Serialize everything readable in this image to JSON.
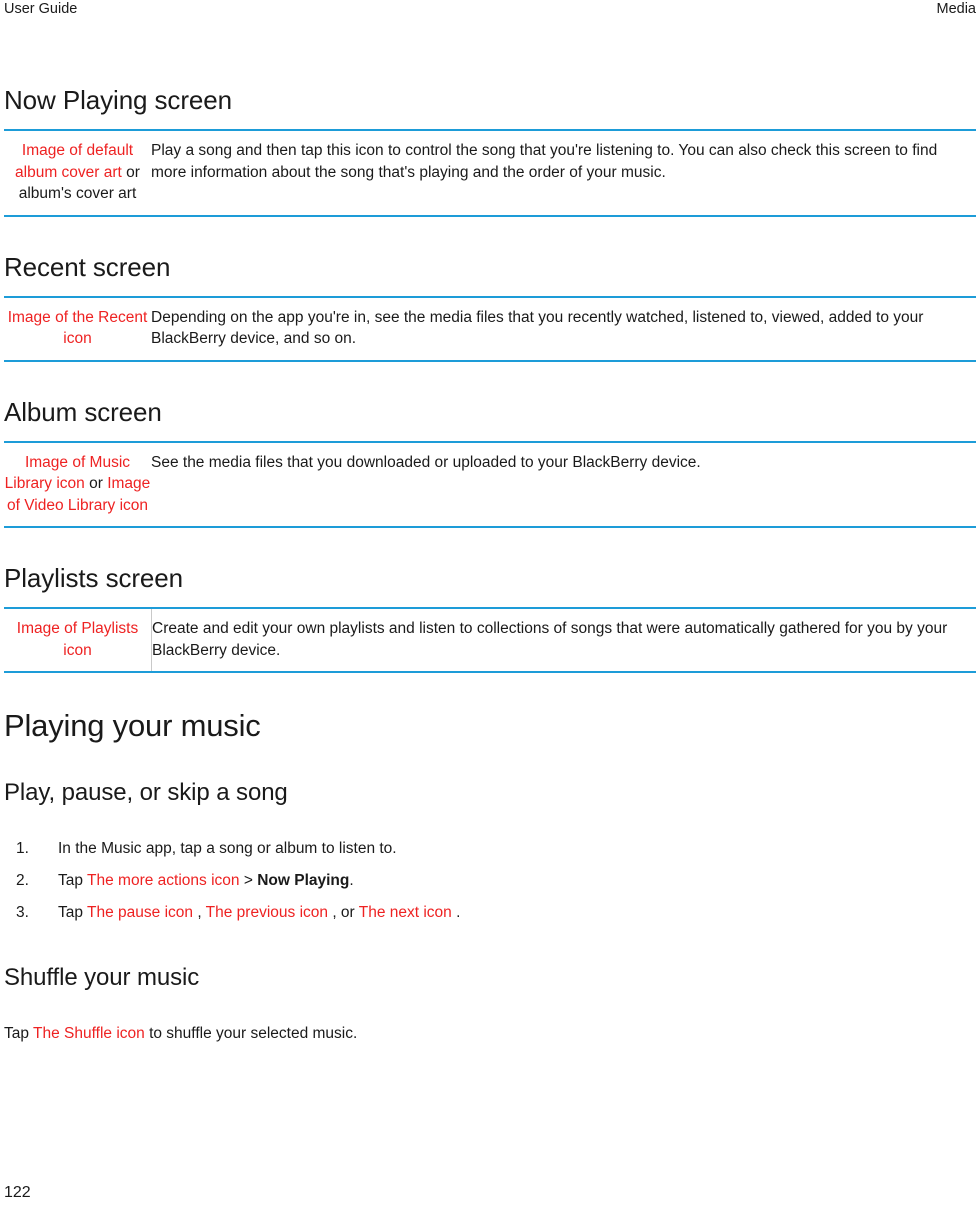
{
  "header": {
    "left": "User Guide",
    "right": "Media"
  },
  "accent_color": "#1d9cd8",
  "image_ref_color": "#ee2222",
  "sections": {
    "now_playing": {
      "heading": "Now Playing screen",
      "row": {
        "icon_ref_1": "Image of default album cover art",
        "connector": "or",
        "icon_ref_2": "album's cover art",
        "description": "Play a song and then tap this icon to control the song that you're listening to. You can also check this screen to find more information about the song that's playing and the order of your music."
      }
    },
    "recent": {
      "heading": "Recent screen",
      "row": {
        "icon_ref_1": "Image of the Recent icon",
        "description": "Depending on the app you're in, see the media files that you recently watched, listened to, viewed, added to your BlackBerry device, and so on."
      }
    },
    "album": {
      "heading": "Album screen",
      "row": {
        "icon_ref_1": "Image of Music Library icon",
        "connector": "or",
        "icon_ref_2": "Image of Video Library icon",
        "description": "See the media files that you downloaded or uploaded to your BlackBerry device."
      }
    },
    "playlists": {
      "heading": "Playlists screen",
      "row": {
        "icon_ref_1": "Image of Playlists icon",
        "description": "Create and edit your own playlists and listen to collections of songs that were automatically gathered for you by your BlackBerry device."
      }
    },
    "playing_your_music": {
      "heading": "Playing your music"
    },
    "play_pause_skip": {
      "heading": "Play, pause, or skip a song",
      "steps": [
        {
          "parts": [
            {
              "text": "In the Music app, tap a song or album to listen to.",
              "style": "plain"
            }
          ]
        },
        {
          "parts": [
            {
              "text": "Tap ",
              "style": "plain"
            },
            {
              "text": "The more actions icon",
              "style": "image-ref"
            },
            {
              "text": " > ",
              "style": "plain"
            },
            {
              "text": "Now Playing",
              "style": "bold"
            },
            {
              "text": ".",
              "style": "plain"
            }
          ]
        },
        {
          "parts": [
            {
              "text": "Tap ",
              "style": "plain"
            },
            {
              "text": "The pause icon",
              "style": "image-ref"
            },
            {
              "text": " , ",
              "style": "plain"
            },
            {
              "text": "The previous icon",
              "style": "image-ref"
            },
            {
              "text": " , or ",
              "style": "plain"
            },
            {
              "text": "The next icon",
              "style": "image-ref"
            },
            {
              "text": " .",
              "style": "plain"
            }
          ]
        }
      ]
    },
    "shuffle": {
      "heading": "Shuffle your music",
      "paragraph": {
        "prefix": "Tap ",
        "icon_ref": "The Shuffle icon",
        "suffix": " to shuffle your selected music."
      }
    }
  },
  "footer": {
    "page_number": "122"
  }
}
